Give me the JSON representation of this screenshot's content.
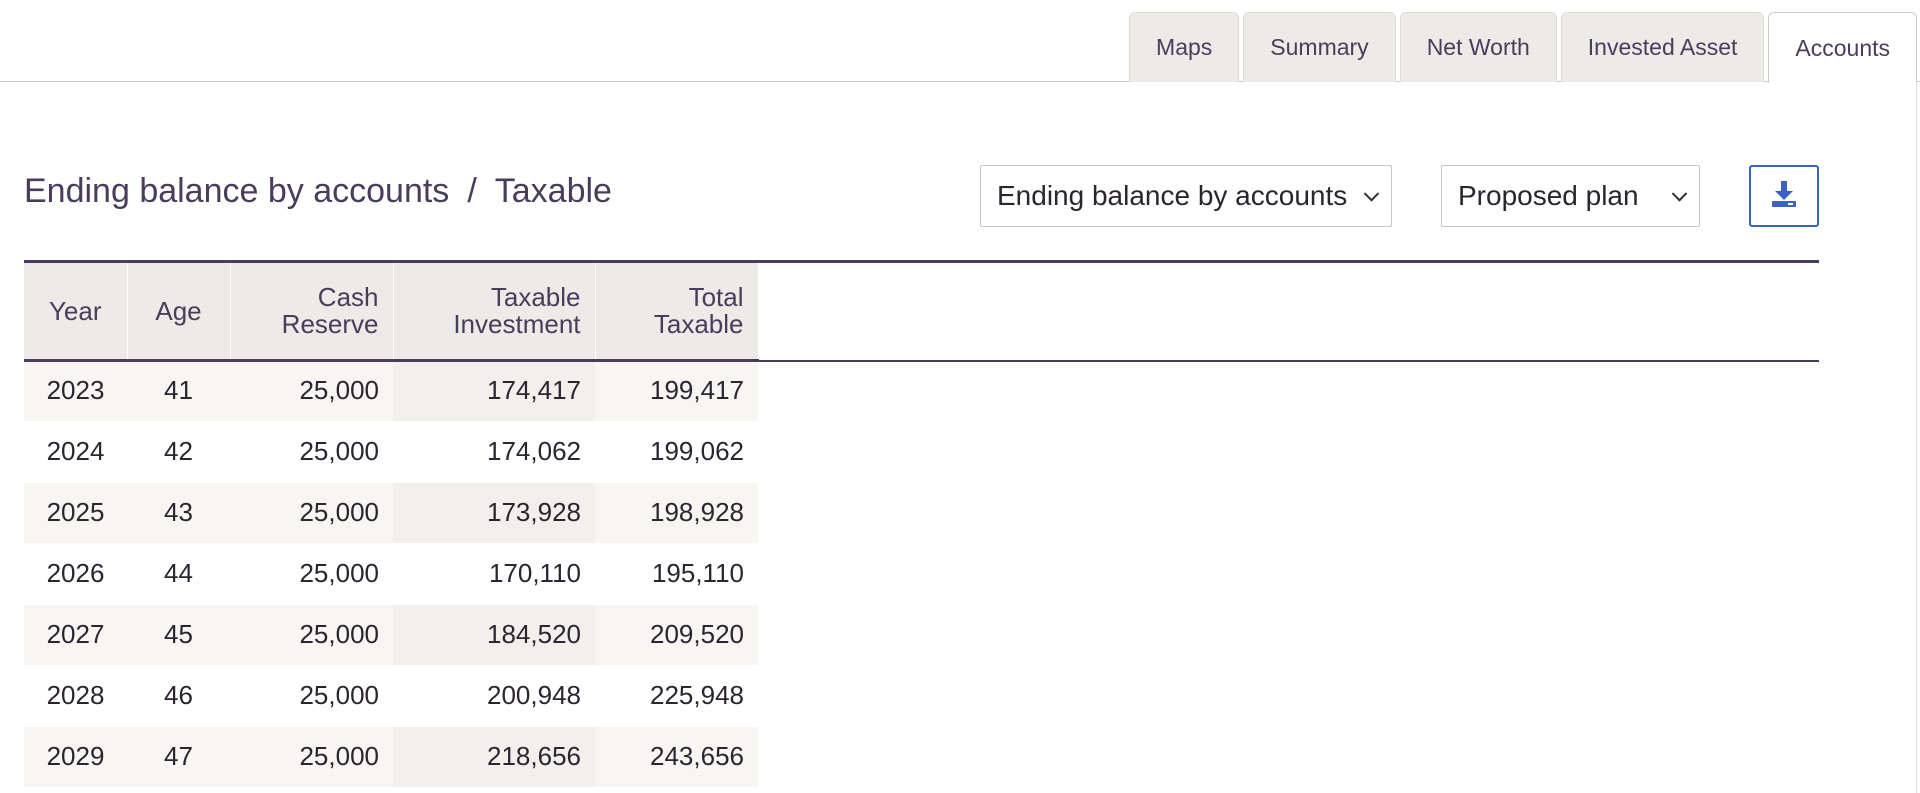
{
  "tabs": [
    {
      "label": "Maps",
      "active": false
    },
    {
      "label": "Summary",
      "active": false
    },
    {
      "label": "Net Worth",
      "active": false
    },
    {
      "label": "Invested Asset",
      "active": false
    },
    {
      "label": "Accounts",
      "active": true
    }
  ],
  "breadcrumb": {
    "primary": "Ending balance by accounts",
    "separator": "/",
    "secondary": "Taxable"
  },
  "controls": {
    "view_select": {
      "selected": "Ending balance by accounts"
    },
    "plan_select": {
      "selected": "Proposed plan"
    },
    "download_icon": "download-icon"
  },
  "table": {
    "headers": {
      "year": "Year",
      "age": "Age",
      "cash_line1": "Cash",
      "cash_line2": "Reserve",
      "inv_line1": "Taxable",
      "inv_line2": "Investment",
      "tot_line1": "Total",
      "tot_line2": "Taxable"
    },
    "rows": [
      {
        "year": "2023",
        "age": "41",
        "cash": "25,000",
        "investment": "174,417",
        "total": "199,417"
      },
      {
        "year": "2024",
        "age": "42",
        "cash": "25,000",
        "investment": "174,062",
        "total": "199,062"
      },
      {
        "year": "2025",
        "age": "43",
        "cash": "25,000",
        "investment": "173,928",
        "total": "198,928"
      },
      {
        "year": "2026",
        "age": "44",
        "cash": "25,000",
        "investment": "170,110",
        "total": "195,110"
      },
      {
        "year": "2027",
        "age": "45",
        "cash": "25,000",
        "investment": "184,520",
        "total": "209,520"
      },
      {
        "year": "2028",
        "age": "46",
        "cash": "25,000",
        "investment": "200,948",
        "total": "225,948"
      },
      {
        "year": "2029",
        "age": "47",
        "cash": "25,000",
        "investment": "218,656",
        "total": "243,656"
      }
    ]
  },
  "colors": {
    "text": "#4a3d5c",
    "tab_bg": "#ecebe7",
    "accent_blue": "#3a62c7"
  }
}
